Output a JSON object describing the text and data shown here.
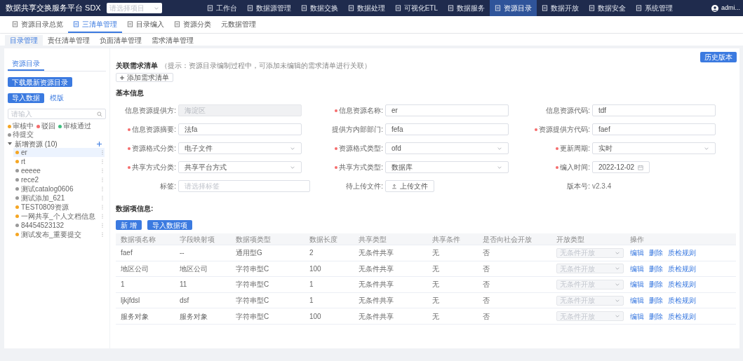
{
  "app_title": "数据共享交换服务平台 SDX",
  "project_select": {
    "placeholder": "请选择项目"
  },
  "nav": [
    {
      "label": "工作台",
      "selected": false
    },
    {
      "label": "数据源管理",
      "selected": false
    },
    {
      "label": "数据交换",
      "selected": false
    },
    {
      "label": "数据处理",
      "selected": false
    },
    {
      "label": "可视化ETL",
      "selected": false
    },
    {
      "label": "数据服务",
      "selected": false
    },
    {
      "label": "资源目录",
      "selected": true
    },
    {
      "label": "数据开放",
      "selected": false
    },
    {
      "label": "数据安全",
      "selected": false
    },
    {
      "label": "系统管理",
      "selected": false
    }
  ],
  "user": "admi...",
  "module_tabs": [
    {
      "label": "资源目录总览",
      "selected": false,
      "icon": true
    },
    {
      "label": "三清单管理",
      "selected": true,
      "icon": true
    },
    {
      "label": "目录编入",
      "selected": false,
      "icon": true
    },
    {
      "label": "资源分类",
      "selected": false,
      "icon": true
    },
    {
      "label": "元数据管理",
      "selected": false,
      "icon": false
    }
  ],
  "sub_tabs": [
    {
      "label": "目录管理",
      "selected": true
    },
    {
      "label": "责任清单管理",
      "selected": false
    },
    {
      "label": "负面清单管理",
      "selected": false
    },
    {
      "label": "需求清单管理",
      "selected": false
    }
  ],
  "sidebar": {
    "tab": "资源目录",
    "download_button": "下载最新资源目录",
    "import_button": "导入数据",
    "template_link": "模版",
    "search": {
      "placeholder": "请输入"
    },
    "legend": [
      {
        "label": "审核中",
        "color": "#f5a623"
      },
      {
        "label": "驳回",
        "color": "#f56c6c"
      },
      {
        "label": "审核通过",
        "color": "#3fbf7f"
      },
      {
        "label": "待提交",
        "color": "#999999"
      }
    ],
    "tree": {
      "label": "新增资源 (10)",
      "expanded": true,
      "children": [
        {
          "label": "er",
          "color": "#f5a623",
          "selected": true
        },
        {
          "label": "rt",
          "color": "#f5a623",
          "selected": false
        },
        {
          "label": "eeeee",
          "color": "#999999",
          "selected": false
        },
        {
          "label": "rece2",
          "color": "#999999",
          "selected": false
        },
        {
          "label": "测试catalog0606",
          "color": "#999999",
          "selected": false
        },
        {
          "label": "测试添加_621",
          "color": "#999999",
          "selected": false
        },
        {
          "label": "TEST0809资源",
          "color": "#f5a623",
          "selected": false
        },
        {
          "label": "一网共享_个人文档信息",
          "color": "#f5a623",
          "selected": false
        },
        {
          "label": "84454523132",
          "color": "#999999",
          "selected": false
        },
        {
          "label": "测试发布_重要提交",
          "color": "#f5a623",
          "selected": false
        }
      ]
    }
  },
  "history_button": "历史版本",
  "related": {
    "title": "关联需求清单",
    "hint": "（提示：资源目录编制过程中，可添加未编辑的需求清单进行关联）",
    "add_button": "添加需求清单"
  },
  "basic_info": {
    "title": "基本信息",
    "fields": [
      {
        "label": "信息资源提供方:",
        "required": false,
        "kind": "input",
        "value": "海淀区",
        "disabled": true
      },
      {
        "label": "信息资源名称:",
        "required": true,
        "kind": "input",
        "value": "er",
        "disabled": false
      },
      {
        "label": "信息资源代码:",
        "required": false,
        "kind": "input",
        "value": "tdf",
        "disabled": false
      },
      {
        "label": "信息资源摘要:",
        "required": true,
        "kind": "input",
        "value": "法fa",
        "disabled": false
      },
      {
        "label": "提供方内部部门:",
        "required": false,
        "kind": "input",
        "value": "fefa",
        "disabled": false
      },
      {
        "label": "资源提供方代码:",
        "required": true,
        "kind": "input",
        "value": "faef",
        "disabled": false
      },
      {
        "label": "资源格式分类:",
        "required": true,
        "kind": "select",
        "value": "电子文件"
      },
      {
        "label": "资源格式类型:",
        "required": true,
        "kind": "select",
        "value": "ofd"
      },
      {
        "label": "更新周期:",
        "required": true,
        "kind": "select",
        "value": "实时"
      },
      {
        "label": "共享方式分类:",
        "required": true,
        "kind": "select",
        "value": "共享平台方式"
      },
      {
        "label": "共享方式类型:",
        "required": true,
        "kind": "select",
        "value": "数据库"
      },
      {
        "label": "编入时间:",
        "required": true,
        "kind": "date",
        "value": "2022-12-02"
      },
      {
        "label": "标签:",
        "required": false,
        "kind": "tags",
        "placeholder": "请选择标签"
      },
      {
        "label": "待上传文件:",
        "required": false,
        "kind": "upload",
        "value": "上传文件"
      },
      {
        "label": "版本号:",
        "required": false,
        "kind": "text",
        "value": "v2.3.4"
      }
    ]
  },
  "data_items": {
    "title": "数据项信息:",
    "buttons": [
      "新 增",
      "导入数据项"
    ],
    "columns": [
      "数据项名称",
      "字段映射项",
      "数据项类型",
      "数据长度",
      "共享类型",
      "共享条件",
      "是否向社会开放",
      "开放类型",
      "操作"
    ],
    "rows": [
      {
        "cells": [
          "faef",
          "--",
          "通用型G",
          "2",
          "无条件共享",
          "无",
          "否"
        ],
        "open_type": "无条件开放",
        "actions": [
          "编辑",
          "删除",
          "质检规则"
        ]
      },
      {
        "cells": [
          "地区公司",
          "地区公司",
          "字符串型C",
          "100",
          "无条件共享",
          "无",
          "否"
        ],
        "open_type": "无条件开放",
        "actions": [
          "编辑",
          "删除",
          "质检规则"
        ]
      },
      {
        "cells": [
          "1",
          "11",
          "字符串型C",
          "1",
          "无条件共享",
          "无",
          "否"
        ],
        "open_type": "无条件开放",
        "actions": [
          "编辑",
          "删除",
          "质检规则"
        ]
      },
      {
        "cells": [
          "ljkjfdsl",
          "dsf",
          "字符串型C",
          "1",
          "无条件共享",
          "无",
          "否"
        ],
        "open_type": "无条件开放",
        "actions": [
          "编辑",
          "删除",
          "质检规则"
        ]
      },
      {
        "cells": [
          "服务对象",
          "服务对象",
          "字符串型C",
          "100",
          "无条件共享",
          "无",
          "否"
        ],
        "open_type": "无条件开放",
        "actions": [
          "编辑",
          "删除",
          "质检规则"
        ]
      }
    ]
  }
}
